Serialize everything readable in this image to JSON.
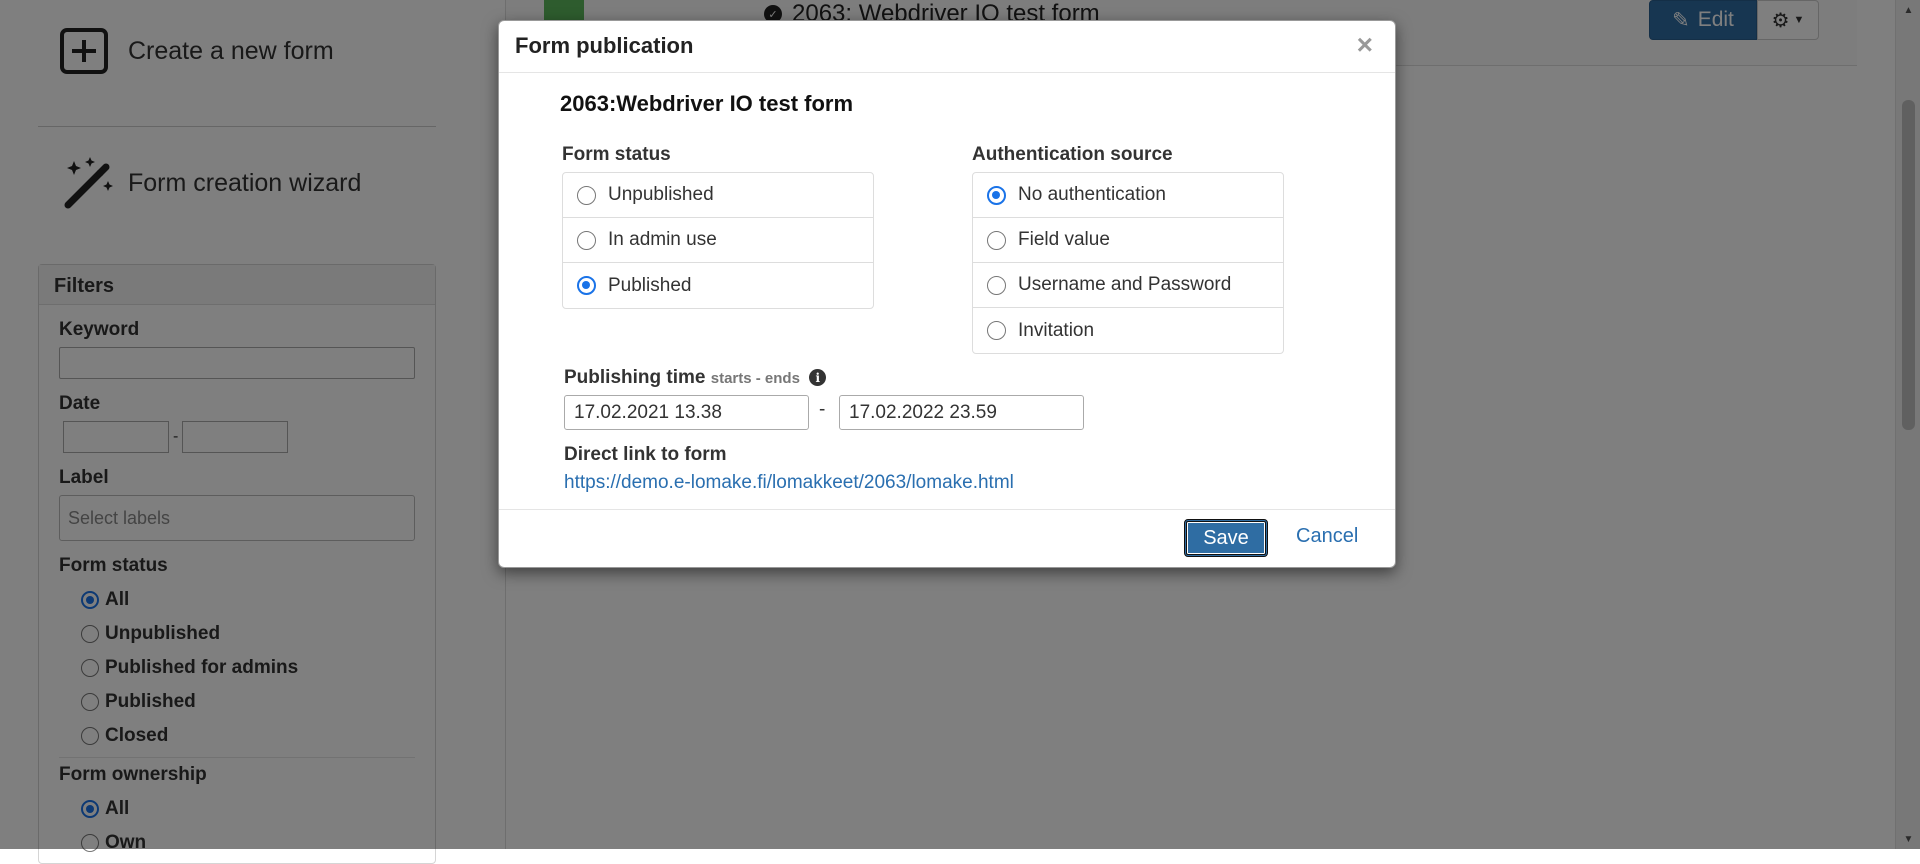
{
  "sidebar": {
    "create_label": "Create a new form",
    "wizard_label": "Form creation wizard",
    "filters": {
      "title": "Filters",
      "keyword_label": "Keyword",
      "date_label": "Date",
      "date_sep": "-",
      "label_label": "Label",
      "label_placeholder": "Select labels",
      "form_status_label": "Form status",
      "form_status_options": [
        "All",
        "Unpublished",
        "Published for admins",
        "Published",
        "Closed"
      ],
      "form_ownership_label": "Form ownership",
      "form_ownership_options": [
        "All",
        "Own"
      ]
    }
  },
  "header": {
    "form_title": "2063: Webdriver IO test form",
    "edit_label": "Edit"
  },
  "modal": {
    "title": "Form publication",
    "close_symbol": "×",
    "form_name": "2063:Webdriver IO test form",
    "form_status": {
      "label": "Form status",
      "options": [
        "Unpublished",
        "In admin use",
        "Published"
      ],
      "selected": "Published"
    },
    "auth_source": {
      "label": "Authentication source",
      "options": [
        "No authentication",
        "Field value",
        "Username and Password",
        "Invitation"
      ],
      "selected": "No authentication"
    },
    "publishing_time": {
      "label": "Publishing time",
      "sub_label": "starts - ends",
      "start": "17.02.2021 13.38",
      "separator": "-",
      "end": "17.02.2022 23.59"
    },
    "direct_link": {
      "label": "Direct link to form",
      "url": "https://demo.e-lomake.fi/lomakkeet/2063/lomake.html"
    },
    "save_label": "Save",
    "cancel_label": "Cancel"
  },
  "colors": {
    "primary": "#2f6da3",
    "link": "#2a6fb0",
    "radio_selected": "#1a73e8",
    "overlay": "rgba(0,0,0,0.5)"
  }
}
